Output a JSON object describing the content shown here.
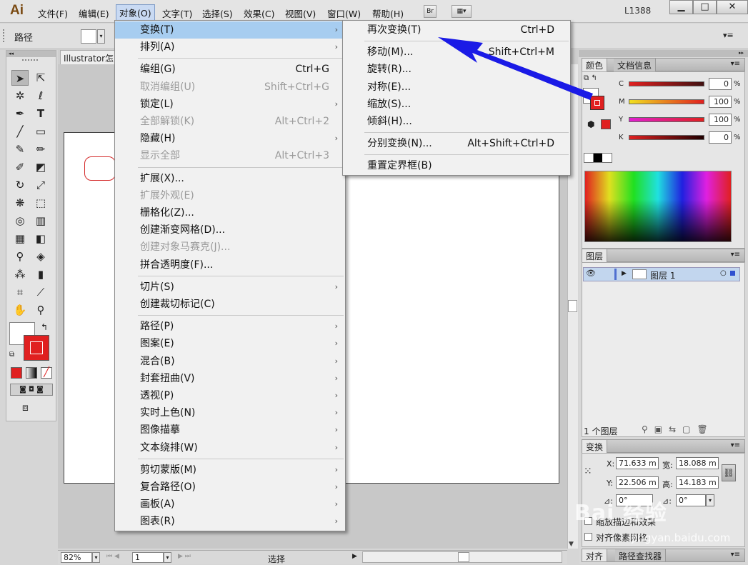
{
  "app": {
    "logo": "Ai",
    "title_right": "L1388"
  },
  "menubar": [
    "文件(F)",
    "编辑(E)",
    "对象(O)",
    "文字(T)",
    "选择(S)",
    "效果(C)",
    "视图(V)",
    "窗口(W)",
    "帮助(H)"
  ],
  "bridge_label": "Br",
  "control_bar": {
    "label": "路径"
  },
  "document": {
    "tab": "Illustrator怎"
  },
  "status": {
    "zoom": "82%",
    "page": "1",
    "mode": "选择"
  },
  "object_menu": [
    {
      "label": "变换(T)",
      "shortcut": "",
      "submenu": true,
      "disabled": false,
      "highlight": true
    },
    {
      "label": "排列(A)",
      "shortcut": "",
      "submenu": true,
      "disabled": false
    },
    {
      "sep": true
    },
    {
      "label": "编组(G)",
      "shortcut": "Ctrl+G",
      "submenu": false,
      "disabled": false
    },
    {
      "label": "取消编组(U)",
      "shortcut": "Shift+Ctrl+G",
      "submenu": false,
      "disabled": true
    },
    {
      "label": "锁定(L)",
      "shortcut": "",
      "submenu": true,
      "disabled": false
    },
    {
      "label": "全部解锁(K)",
      "shortcut": "Alt+Ctrl+2",
      "submenu": false,
      "disabled": true
    },
    {
      "label": "隐藏(H)",
      "shortcut": "",
      "submenu": true,
      "disabled": false
    },
    {
      "label": "显示全部",
      "shortcut": "Alt+Ctrl+3",
      "submenu": false,
      "disabled": true
    },
    {
      "sep": true
    },
    {
      "label": "扩展(X)...",
      "shortcut": "",
      "submenu": false,
      "disabled": false
    },
    {
      "label": "扩展外观(E)",
      "shortcut": "",
      "submenu": false,
      "disabled": true
    },
    {
      "label": "栅格化(Z)...",
      "shortcut": "",
      "submenu": false,
      "disabled": false
    },
    {
      "label": "创建渐变网格(D)...",
      "shortcut": "",
      "submenu": false,
      "disabled": false
    },
    {
      "label": "创建对象马赛克(J)...",
      "shortcut": "",
      "submenu": false,
      "disabled": true
    },
    {
      "label": "拼合透明度(F)...",
      "shortcut": "",
      "submenu": false,
      "disabled": false
    },
    {
      "sep": true
    },
    {
      "label": "切片(S)",
      "shortcut": "",
      "submenu": true,
      "disabled": false
    },
    {
      "label": "创建裁切标记(C)",
      "shortcut": "",
      "submenu": false,
      "disabled": false
    },
    {
      "sep": true
    },
    {
      "label": "路径(P)",
      "shortcut": "",
      "submenu": true,
      "disabled": false
    },
    {
      "label": "图案(E)",
      "shortcut": "",
      "submenu": true,
      "disabled": false
    },
    {
      "label": "混合(B)",
      "shortcut": "",
      "submenu": true,
      "disabled": false
    },
    {
      "label": "封套扭曲(V)",
      "shortcut": "",
      "submenu": true,
      "disabled": false
    },
    {
      "label": "透视(P)",
      "shortcut": "",
      "submenu": true,
      "disabled": false
    },
    {
      "label": "实时上色(N)",
      "shortcut": "",
      "submenu": true,
      "disabled": false
    },
    {
      "label": "图像描摹",
      "shortcut": "",
      "submenu": true,
      "disabled": false
    },
    {
      "label": "文本绕排(W)",
      "shortcut": "",
      "submenu": true,
      "disabled": false
    },
    {
      "sep": true
    },
    {
      "label": "剪切蒙版(M)",
      "shortcut": "",
      "submenu": true,
      "disabled": false
    },
    {
      "label": "复合路径(O)",
      "shortcut": "",
      "submenu": true,
      "disabled": false
    },
    {
      "label": "画板(A)",
      "shortcut": "",
      "submenu": true,
      "disabled": false
    },
    {
      "label": "图表(R)",
      "shortcut": "",
      "submenu": true,
      "disabled": false
    }
  ],
  "transform_submenu": [
    {
      "label": "再次变换(T)",
      "shortcut": "Ctrl+D"
    },
    {
      "sep": true
    },
    {
      "label": "移动(M)...",
      "shortcut": "Shift+Ctrl+M"
    },
    {
      "label": "旋转(R)...",
      "shortcut": ""
    },
    {
      "label": "对称(E)...",
      "shortcut": ""
    },
    {
      "label": "缩放(S)...",
      "shortcut": ""
    },
    {
      "label": "倾斜(H)...",
      "shortcut": ""
    },
    {
      "sep": true
    },
    {
      "label": "分别变换(N)...",
      "shortcut": "Alt+Shift+Ctrl+D"
    },
    {
      "sep": true
    },
    {
      "label": "重置定界框(B)",
      "shortcut": ""
    }
  ],
  "color_panel": {
    "tabs": [
      "颜色",
      "文档信息"
    ],
    "channels": [
      {
        "name": "C",
        "value": "0",
        "unit": "%"
      },
      {
        "name": "M",
        "value": "100",
        "unit": "%"
      },
      {
        "name": "Y",
        "value": "100",
        "unit": "%"
      },
      {
        "name": "K",
        "value": "0",
        "unit": "%"
      }
    ]
  },
  "layers_panel": {
    "title": "图层",
    "layer_name": "图层 1",
    "count": "1 个图层"
  },
  "transform_panel": {
    "title": "变换",
    "x_label": "X:",
    "x": "71.633 m",
    "y_label": "Y:",
    "y": "22.506 m",
    "w_label": "宽:",
    "w": "18.088 m",
    "h_label": "高:",
    "h": "14.183 m",
    "angle1": "0°",
    "angle2": "0°",
    "check1": "缩放描边和效果",
    "check2": "对齐像素网格"
  },
  "bottom_tabs": [
    "对齐",
    "路径查找器"
  ],
  "watermark": {
    "text": "Bai 经验",
    "sub": "jingyan.baidu.com"
  },
  "colors": {
    "accent_fill": "#e02020",
    "highlight": "#a7cdf0",
    "arrow": "#1a1ae6"
  }
}
